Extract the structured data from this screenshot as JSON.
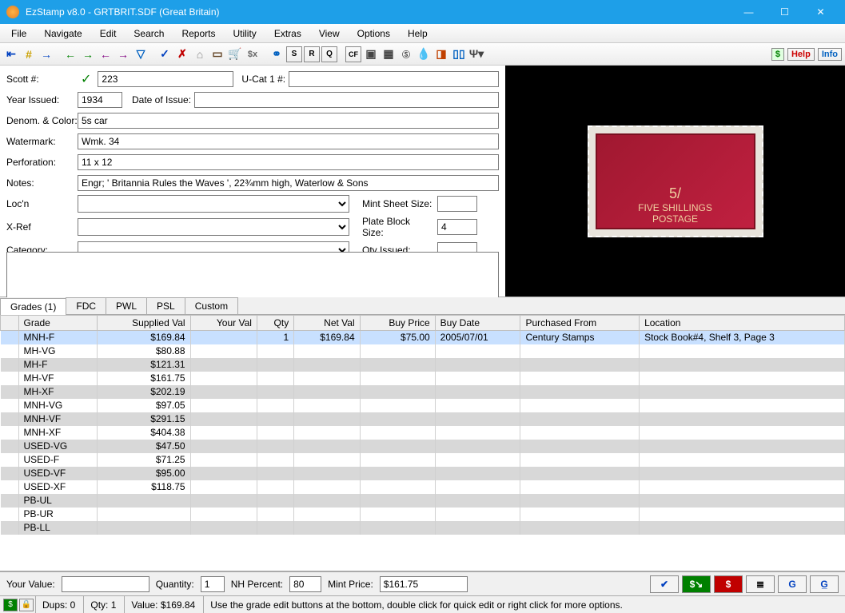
{
  "window": {
    "title": "EzStamp v8.0 - GRTBRIT.SDF (Great Britain)"
  },
  "menu": [
    "File",
    "Navigate",
    "Edit",
    "Search",
    "Reports",
    "Utility",
    "Extras",
    "View",
    "Options",
    "Help"
  ],
  "rightbtns": {
    "help": "Help",
    "info": "Info"
  },
  "form": {
    "scott_label": "Scott #:",
    "scott": "223",
    "ucat_label": "U-Cat 1 #:",
    "ucat": "",
    "year_label": "Year Issued:",
    "year": "1934",
    "doi_label": "Date of Issue:",
    "doi": "",
    "denom_label": "Denom. & Color:",
    "denom": "5s car",
    "wmk_label": "Watermark:",
    "wmk": "Wmk. 34",
    "perf_label": "Perforation:",
    "perf": "11 x 12",
    "notes_label": "Notes:",
    "notes": "Engr; ' Britannia Rules the Waves ', 22¾mm high, Waterlow & Sons",
    "locn_label": "Loc'n",
    "locn": "",
    "xref_label": "X-Ref",
    "xref": "",
    "cat_label": "Category:",
    "cat": "",
    "mss_label": "Mint Sheet Size:",
    "mss": "",
    "pbs_label": "Plate Block Size:",
    "pbs": "4",
    "qi_label": "Qty Issued:",
    "qi": ""
  },
  "stamp_text": "FIVE SHILLINGS",
  "tabs": [
    "Grades (1)",
    "FDC",
    "PWL",
    "PSL",
    "Custom"
  ],
  "cols": [
    "Grade",
    "Supplied Val",
    "Your Val",
    "Qty",
    "Net Val",
    "Buy Price",
    "Buy Date",
    "Purchased From",
    "Location"
  ],
  "rows": [
    {
      "grade": "MNH-F",
      "sval": "$169.84",
      "yval": "",
      "qty": "1",
      "nval": "$169.84",
      "bprice": "$75.00",
      "bdate": "2005/07/01",
      "pfrom": "Century Stamps",
      "loc": "Stock Book#4, Shelf 3, Page 3",
      "sel": true
    },
    {
      "grade": "MH-VG",
      "sval": "$80.88"
    },
    {
      "grade": "MH-F",
      "sval": "$121.31"
    },
    {
      "grade": "MH-VF",
      "sval": "$161.75"
    },
    {
      "grade": "MH-XF",
      "sval": "$202.19"
    },
    {
      "grade": "MNH-VG",
      "sval": "$97.05"
    },
    {
      "grade": "MNH-VF",
      "sval": "$291.15"
    },
    {
      "grade": "MNH-XF",
      "sval": "$404.38"
    },
    {
      "grade": "USED-VG",
      "sval": "$47.50"
    },
    {
      "grade": "USED-F",
      "sval": "$71.25"
    },
    {
      "grade": "USED-VF",
      "sval": "$95.00"
    },
    {
      "grade": "USED-XF",
      "sval": "$118.75"
    },
    {
      "grade": "PB-UL",
      "sval": ""
    },
    {
      "grade": "PB-UR",
      "sval": ""
    },
    {
      "grade": "PB-LL",
      "sval": ""
    }
  ],
  "bottom": {
    "yv_label": "Your Value:",
    "yv": "",
    "qty_label": "Quantity:",
    "qty": "1",
    "nh_label": "NH Percent:",
    "nh": "80",
    "mp_label": "Mint Price:",
    "mp": "$161.75"
  },
  "status": {
    "dups": "Dups: 0",
    "qty": "Qty: 1",
    "value": "Value: $169.84",
    "hint": "Use the grade edit buttons at the bottom, double click for quick edit or right click for more options."
  }
}
